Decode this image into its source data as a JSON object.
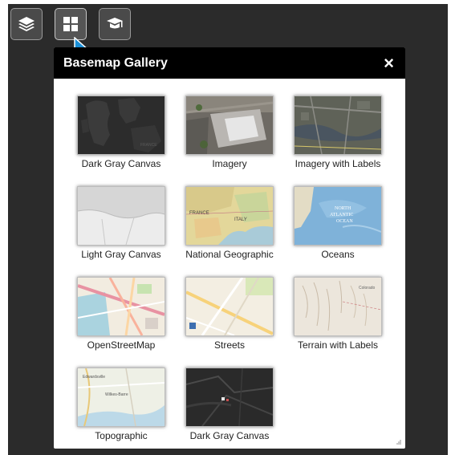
{
  "toolbar": {
    "layers_icon": "layers-icon",
    "basemap_icon": "grid-icon",
    "legend_icon": "mortarboard-icon"
  },
  "panel": {
    "title": "Basemap Gallery",
    "close_label": "×"
  },
  "basemaps": [
    {
      "label": "Dark Gray Canvas",
      "style": "dark-gray"
    },
    {
      "label": "Imagery",
      "style": "imagery"
    },
    {
      "label": "Imagery with Labels",
      "style": "imagery-labels"
    },
    {
      "label": "Light Gray Canvas",
      "style": "light-gray"
    },
    {
      "label": "National Geographic",
      "style": "natgeo"
    },
    {
      "label": "Oceans",
      "style": "oceans"
    },
    {
      "label": "OpenStreetMap",
      "style": "osm"
    },
    {
      "label": "Streets",
      "style": "streets"
    },
    {
      "label": "Terrain with Labels",
      "style": "terrain"
    },
    {
      "label": "Topographic",
      "style": "topo"
    },
    {
      "label": "Dark Gray Canvas",
      "style": "dark-vector"
    }
  ],
  "colors": {
    "app_bg": "#2b2b2b",
    "header_bg": "#000000",
    "cursor": "#1a8fd8"
  }
}
